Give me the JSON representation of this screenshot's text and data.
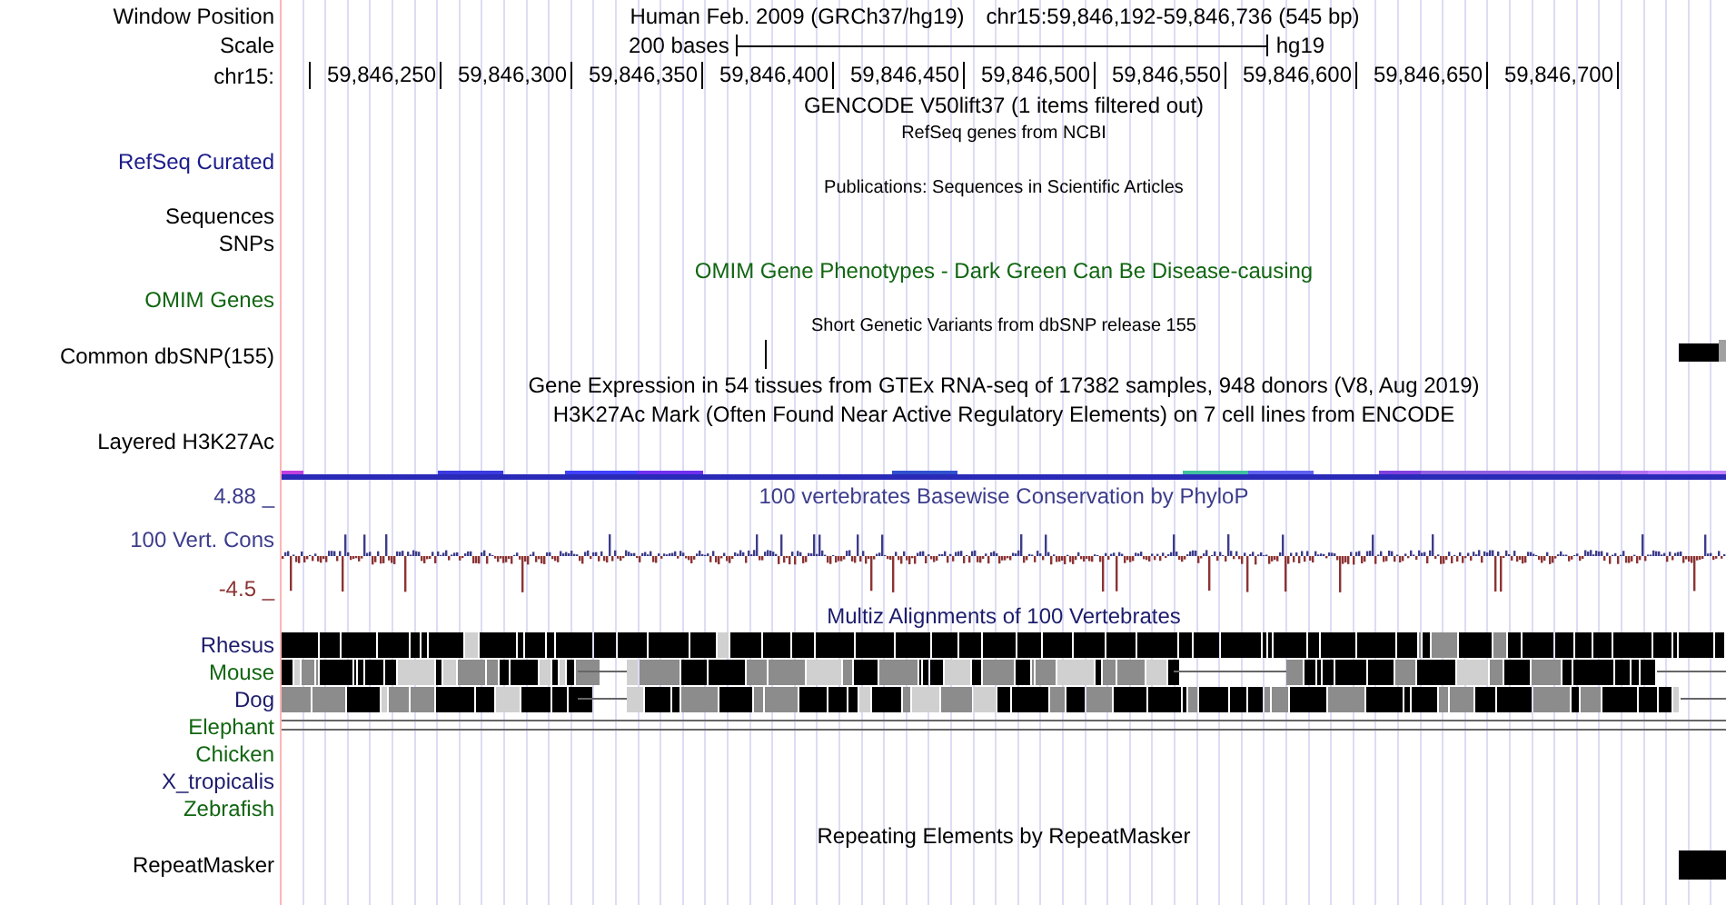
{
  "rows": [
    {
      "kind": "position",
      "label": "Window Position",
      "assembly_title": "Human Feb. 2009 (GRCh37/hg19)",
      "range": "chr15:59,846,192-59,846,736 (545 bp)"
    },
    {
      "kind": "scale",
      "label": "Scale",
      "length": "200 bases",
      "assembly": "hg19"
    },
    {
      "kind": "ruler",
      "label": "chr15:",
      "ticks": [
        "59,846,250",
        "59,846,300",
        "59,846,350",
        "59,846,400",
        "59,846,450",
        "59,846,500",
        "59,846,550",
        "59,846,600",
        "59,846,650",
        "59,846,700"
      ]
    },
    {
      "kind": "title",
      "title": "GENCODE V50lift37 (1 items filtered out)"
    },
    {
      "kind": "subtitle",
      "title": "RefSeq genes from NCBI"
    },
    {
      "kind": "label",
      "label": "RefSeq Curated",
      "color": "#1c1c8c"
    },
    {
      "kind": "subtitle",
      "title": "Publications: Sequences in Scientific Articles"
    },
    {
      "kind": "label",
      "label": "Sequences"
    },
    {
      "kind": "label",
      "label": "SNPs"
    },
    {
      "kind": "title",
      "title": "OMIM Gene Phenotypes - Dark Green Can Be Disease-causing",
      "color": "#116611"
    },
    {
      "kind": "label",
      "label": "OMIM Genes",
      "color": "#116611"
    },
    {
      "kind": "subtitle",
      "title": "Short Genetic Variants from dbSNP release 155"
    },
    {
      "kind": "snp",
      "label": "Common dbSNP(155)"
    },
    {
      "kind": "title",
      "title": "Gene Expression in 54 tissues from GTEx RNA-seq of 17382 samples, 948 donors (V8, Aug 2019)"
    },
    {
      "kind": "title",
      "title": "H3K27Ac Mark (Often Found Near Active Regulatory Elements) on 7 cell lines from ENCODE"
    },
    {
      "kind": "layered",
      "label": "Layered H3K27Ac"
    },
    {
      "kind": "title",
      "label": "4.88 _",
      "title": "100 vertebrates Basewise Conservation by PhyloP",
      "color": "#3c3c8c"
    },
    {
      "kind": "phylop",
      "label": "100 Vert. Cons",
      "min_label": "-4.5 _",
      "color": "#3c3c8c"
    },
    {
      "kind": "title",
      "title": "Multiz Alignments of 100 Vertebrates",
      "color": "#1c1c6c"
    },
    {
      "kind": "alignment_full",
      "label": "Rhesus",
      "color": "#1c1c6c"
    },
    {
      "kind": "alignment_gapped",
      "label": "Mouse",
      "color": "#116611"
    },
    {
      "kind": "alignment_gapped",
      "label": "Dog",
      "color": "#1c1c6c"
    },
    {
      "kind": "alignment_lines",
      "label": "Elephant",
      "color": "#116611"
    },
    {
      "kind": "alignment_empty",
      "label": "Chicken",
      "color": "#116611"
    },
    {
      "kind": "alignment_empty",
      "label": "X_tropicalis",
      "color": "#1c1c6c"
    },
    {
      "kind": "alignment_empty",
      "label": "Zebrafish",
      "color": "#116611"
    },
    {
      "kind": "title",
      "title": "Repeating Elements by RepeatMasker"
    },
    {
      "kind": "repeat",
      "label": "RepeatMasker"
    }
  ]
}
